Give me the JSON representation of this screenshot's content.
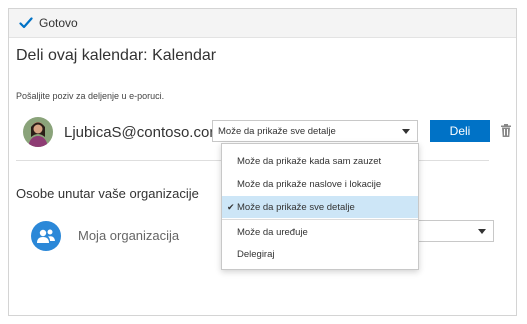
{
  "topbar": {
    "done_label": "Gotovo"
  },
  "dialog": {
    "title": "Deli ovaj kalendar: Kalendar",
    "invite_text": "Pošaljite poziv za deljenje u e-poruci.",
    "user_email": "LjubicaS@contoso.com",
    "permission_selected": "Može da prikaže sve detalje",
    "share_label": "Deli",
    "org_heading": "Osobe unutar vaše organizacije",
    "org_name": "Moja organizacija"
  },
  "dropdown": {
    "items": [
      {
        "label": "Može da prikaže kada sam zauzet",
        "selected": false
      },
      {
        "label": "Može da prikaže naslove i lokacije",
        "selected": false
      },
      {
        "label": "Može da prikaže sve detalje",
        "selected": true
      },
      {
        "label": "Može da uređuje",
        "selected": false
      },
      {
        "label": "Delegiraj",
        "selected": false
      }
    ],
    "tick": "✔"
  },
  "colors": {
    "accent": "#0072c6",
    "selected_bg": "#cde6f7",
    "org_avatar": "#2b88d8"
  }
}
